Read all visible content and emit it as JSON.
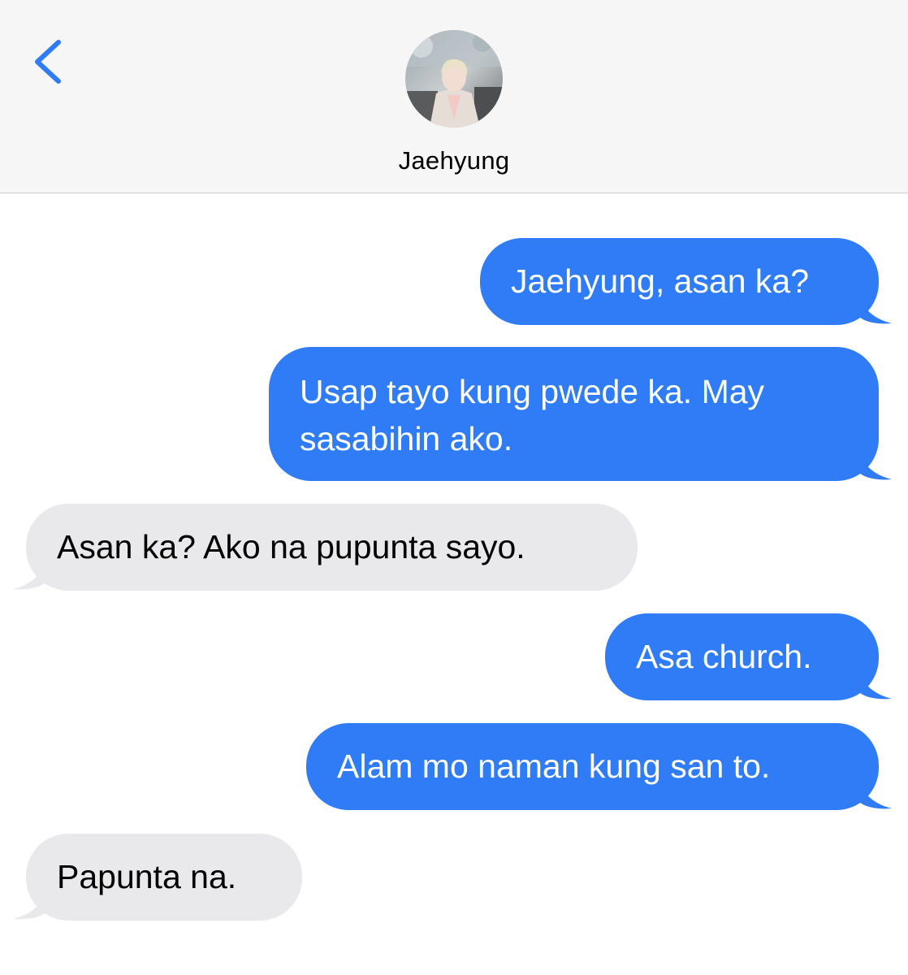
{
  "header": {
    "contact_name": "Jaehyung",
    "back_icon": "chevron-left-icon",
    "accent_color": "#2f7cf6"
  },
  "messages": [
    {
      "direction": "sent",
      "text": "Jaehyung, asan ka?"
    },
    {
      "direction": "sent",
      "text": "Usap tayo kung pwede ka. May sasabihin ako."
    },
    {
      "direction": "received",
      "text": "Asan ka? Ako na pupunta sayo."
    },
    {
      "direction": "sent",
      "text": "Asa church."
    },
    {
      "direction": "sent",
      "text": "Alam mo naman kung san to."
    },
    {
      "direction": "received",
      "text": "Papunta na."
    }
  ],
  "colors": {
    "sent_bubble": "#2f7cf6",
    "received_bubble": "#e9e9eb",
    "header_background": "#f6f6f6"
  }
}
